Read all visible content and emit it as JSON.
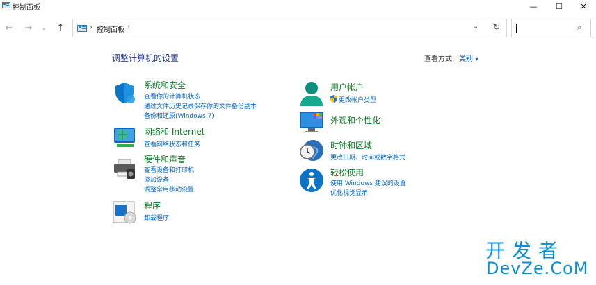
{
  "window": {
    "title": "控制面板",
    "min_glyph": "—",
    "max_glyph": "☐",
    "close_glyph": "✕"
  },
  "nav": {
    "back_glyph": "←",
    "forward_glyph": "→",
    "recent_glyph": "⌄",
    "up_glyph": "↑",
    "breadcrumb_sep": "›",
    "address": "控制面板",
    "address_sep": "›",
    "dropdown_glyph": "⌄",
    "refresh_glyph": "↻",
    "search_icon": "⌕",
    "search_value": ""
  },
  "header": {
    "title": "调整计算机的设置",
    "view_by_label": "查看方式:",
    "view_by_value": "类别 ▾"
  },
  "left": [
    {
      "title": "系统和安全",
      "icon": "shield-icon",
      "links": [
        "查看你的计算机状态",
        "通过文件历史记录保存你的文件备份副本",
        "备份和还原(Windows 7)"
      ]
    },
    {
      "title": "网络和 Internet",
      "icon": "network-icon",
      "links": [
        "查看网络状态和任务"
      ]
    },
    {
      "title": "硬件和声音",
      "icon": "printer-icon",
      "links": [
        "查看设备和打印机",
        "添加设备",
        "调整常用移动设置"
      ]
    },
    {
      "title": "程序",
      "icon": "programs-icon",
      "links": [
        "卸载程序"
      ]
    }
  ],
  "right": [
    {
      "title": "用户帐户",
      "icon": "user-icon",
      "links": [
        "更改帐户类型"
      ]
    },
    {
      "title": "外观和个性化",
      "icon": "appearance-icon",
      "links": []
    },
    {
      "title": "时钟和区域",
      "icon": "clock-globe-icon",
      "links": [
        "更改日期、时间或数字格式"
      ]
    },
    {
      "title": "轻松使用",
      "icon": "accessibility-icon",
      "links": [
        "使用 Windows 建议的设置",
        "优化视觉显示"
      ]
    }
  ],
  "watermark": {
    "cn": "开发者",
    "en": "DevZe.CoM"
  },
  "colors": {
    "category_green": "#0b7a24",
    "link_blue": "#0066cc",
    "title_blue": "#1e3287",
    "watermark_blue": "#0a8fd6"
  }
}
